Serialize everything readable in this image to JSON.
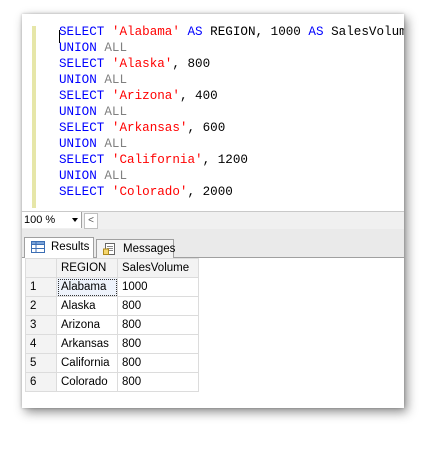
{
  "editor": {
    "lines": [
      [
        {
          "t": "SELECT ",
          "c": "kw"
        },
        {
          "t": "'Alabama'",
          "c": "str"
        },
        {
          "t": " AS ",
          "c": "kw"
        },
        {
          "t": "REGION, 1000 ",
          "c": "plain"
        },
        {
          "t": "AS ",
          "c": "kw"
        },
        {
          "t": "SalesVolume",
          "c": "plain"
        }
      ],
      [
        {
          "t": "UNION ",
          "c": "kw"
        },
        {
          "t": "ALL",
          "c": "gr"
        }
      ],
      [
        {
          "t": "SELECT ",
          "c": "kw"
        },
        {
          "t": "'Alaska'",
          "c": "str"
        },
        {
          "t": ", 800",
          "c": "plain"
        }
      ],
      [
        {
          "t": "UNION ",
          "c": "kw"
        },
        {
          "t": "ALL",
          "c": "gr"
        }
      ],
      [
        {
          "t": "SELECT ",
          "c": "kw"
        },
        {
          "t": "'Arizona'",
          "c": "str"
        },
        {
          "t": ", 400",
          "c": "plain"
        }
      ],
      [
        {
          "t": "UNION ",
          "c": "kw"
        },
        {
          "t": "ALL",
          "c": "gr"
        }
      ],
      [
        {
          "t": "SELECT ",
          "c": "kw"
        },
        {
          "t": "'Arkansas'",
          "c": "str"
        },
        {
          "t": ", 600",
          "c": "plain"
        }
      ],
      [
        {
          "t": "UNION ",
          "c": "kw"
        },
        {
          "t": "ALL",
          "c": "gr"
        }
      ],
      [
        {
          "t": "SELECT ",
          "c": "kw"
        },
        {
          "t": "'California'",
          "c": "str"
        },
        {
          "t": ", 1200",
          "c": "plain"
        }
      ],
      [
        {
          "t": "UNION ",
          "c": "kw"
        },
        {
          "t": "ALL",
          "c": "gr"
        }
      ],
      [
        {
          "t": "SELECT ",
          "c": "kw"
        },
        {
          "t": "'Colorado'",
          "c": "str"
        },
        {
          "t": ", 2000",
          "c": "plain"
        }
      ]
    ]
  },
  "zoom": {
    "value": "100 %",
    "scroll_left": "<"
  },
  "tabs": {
    "results": "Results",
    "messages": "Messages"
  },
  "results": {
    "columns": [
      "REGION",
      "SalesVolume"
    ],
    "rows": [
      {
        "n": "1",
        "region": "Alabama",
        "sales": "1000"
      },
      {
        "n": "2",
        "region": "Alaska",
        "sales": "800"
      },
      {
        "n": "3",
        "region": "Arizona",
        "sales": "800"
      },
      {
        "n": "4",
        "region": "Arkansas",
        "sales": "800"
      },
      {
        "n": "5",
        "region": "California",
        "sales": "800"
      },
      {
        "n": "6",
        "region": "Colorado",
        "sales": "800"
      }
    ]
  },
  "colors": {
    "keyword": "#0000ff",
    "string": "#ff0000",
    "gray_keyword": "#808080"
  }
}
